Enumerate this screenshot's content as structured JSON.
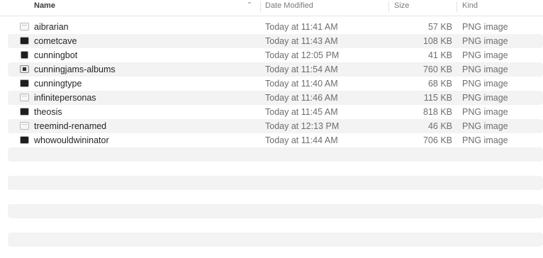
{
  "columns": {
    "name": "Name",
    "date": "Date Modified",
    "size": "Size",
    "kind": "Kind"
  },
  "files": [
    {
      "name": "aibrarian",
      "date": "Today at 11:41 AM",
      "size": "57 KB",
      "kind": "PNG image",
      "icon": "image-thumbnail-light-icon"
    },
    {
      "name": "cometcave",
      "date": "Today at 11:43 AM",
      "size": "108 KB",
      "kind": "PNG image",
      "icon": "image-thumbnail-dark-icon"
    },
    {
      "name": "cunningbot",
      "date": "Today at 12:05 PM",
      "size": "41 KB",
      "kind": "PNG image",
      "icon": "image-thumbnail-dark-icon"
    },
    {
      "name": "cunningjams-albums",
      "date": "Today at 11:54 AM",
      "size": "760 KB",
      "kind": "PNG image",
      "icon": "image-thumbnail-icon"
    },
    {
      "name": "cunningtype",
      "date": "Today at 11:40 AM",
      "size": "68 KB",
      "kind": "PNG image",
      "icon": "image-thumbnail-dark-icon"
    },
    {
      "name": "infinitepersonas",
      "date": "Today at 11:46 AM",
      "size": "115 KB",
      "kind": "PNG image",
      "icon": "image-thumbnail-light-icon"
    },
    {
      "name": "theosis",
      "date": "Today at 11:45 AM",
      "size": "818 KB",
      "kind": "PNG image",
      "icon": "image-thumbnail-dark-icon"
    },
    {
      "name": "treemind-renamed",
      "date": "Today at 12:13 PM",
      "size": "46 KB",
      "kind": "PNG image",
      "icon": "image-thumbnail-light-icon"
    },
    {
      "name": "whowouldwininator",
      "date": "Today at 11:44 AM",
      "size": "706 KB",
      "kind": "PNG image",
      "icon": "image-thumbnail-dark-icon"
    }
  ]
}
